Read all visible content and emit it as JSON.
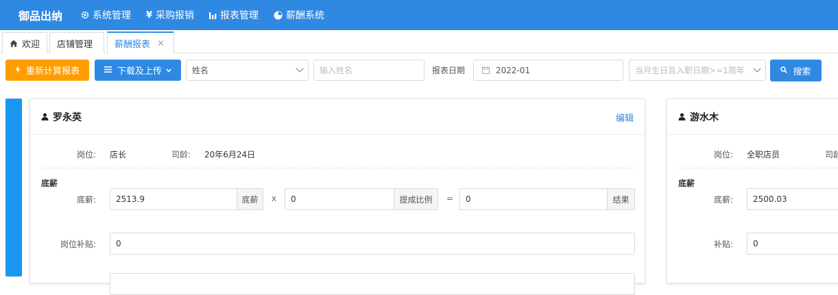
{
  "app": {
    "brand": "御品出纳"
  },
  "nav": [
    {
      "icon": "gear-icon",
      "label": "系统管理"
    },
    {
      "icon": "yen-icon",
      "label": "采购报销"
    },
    {
      "icon": "bar-chart-icon",
      "label": "报表管理"
    },
    {
      "icon": "pie-chart-icon",
      "label": "薪酬系统"
    }
  ],
  "tabs": [
    {
      "icon": "home-icon",
      "label": "欢迎"
    },
    {
      "label": "店铺管理"
    },
    {
      "label": "薪酬报表",
      "active": true,
      "close": "×"
    }
  ],
  "toolbar": {
    "recalc_label": "重新计算报表",
    "download_label": "下载及上传",
    "field_select": "姓名",
    "name_placeholder": "输入姓名",
    "date_label": "报表日期",
    "date_value": "2022-01",
    "filter_placeholder": "当月生日且入职日期>=1周年",
    "search_label": "搜索"
  },
  "cards": [
    {
      "name": "罗永英",
      "edit": "编辑",
      "position_label": "岗位:",
      "position": "店长",
      "seniority_label": "司龄:",
      "seniority": "20年6月24日",
      "section": "底薪",
      "base_label": "底薪:",
      "base_value": "2513.9",
      "base_addon": "底薪",
      "times": "x",
      "ratio_value": "0",
      "ratio_addon": "提成比例",
      "equals": "=",
      "result_value": "0",
      "result_addon": "结果",
      "allowance_label": "岗位补贴:",
      "allowance_value": "0"
    },
    {
      "name": "游水木",
      "position_label": "岗位:",
      "position": "全职店员",
      "seniority_label": "司龄",
      "section": "底薪",
      "base_label": "底薪:",
      "base_value": "2500.03",
      "allowance_label": "补贴:",
      "allowance_value": "0"
    }
  ],
  "colors": {
    "primary": "#2f89e3",
    "orange": "#ff9c00",
    "strip": "#1a96f0"
  }
}
